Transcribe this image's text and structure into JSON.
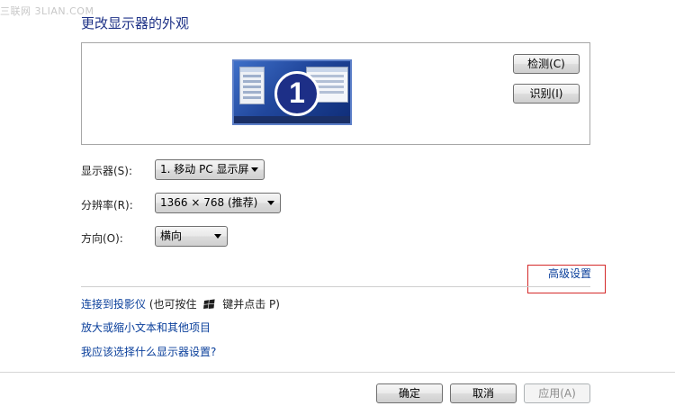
{
  "watermark": "三联网 3LIAN.COM",
  "title": "更改显示器的外观",
  "preview": {
    "monitor_number": "1",
    "detect_button": "检测(C)",
    "identify_button": "识别(I)"
  },
  "settings": {
    "display_label": "显示器(S):",
    "display_value": "1. 移动 PC 显示屏",
    "resolution_label": "分辨率(R):",
    "resolution_value": "1366 × 768 (推荐)",
    "orientation_label": "方向(O):",
    "orientation_value": "横向"
  },
  "advanced_link": "高级设置",
  "links": {
    "projector_link": "连接到投影仪",
    "projector_hint_a": "(也可按住",
    "projector_hint_b": "键并点击 P)",
    "text_size_link": "放大或缩小文本和其他项目",
    "help_link": "我应该选择什么显示器设置?"
  },
  "footer": {
    "ok_button": "确定",
    "cancel_button": "取消",
    "apply_button": "应用(A)"
  },
  "colors": {
    "link": "#0a3f9b",
    "title": "#1e3287",
    "highlight_box": "#d42a2a"
  },
  "icons": [
    "windows-logo-icon",
    "dropdown-arrow-icon",
    "monitor-preview-icon"
  ]
}
